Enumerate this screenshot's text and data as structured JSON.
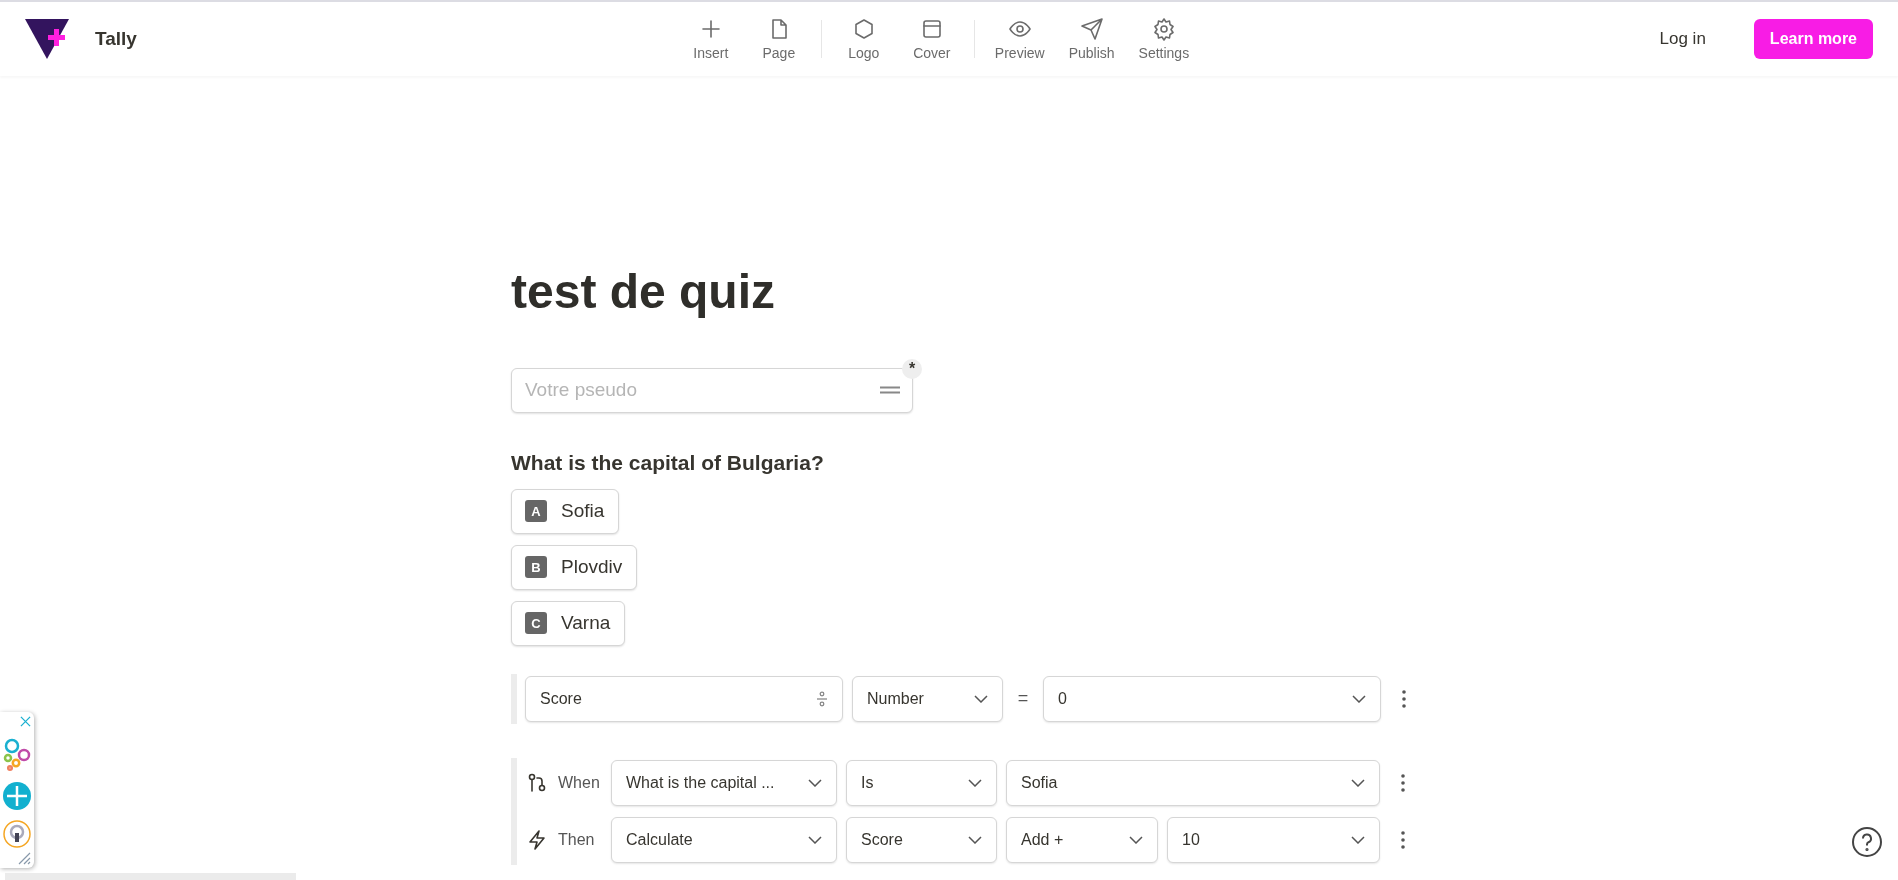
{
  "header": {
    "brand": "Tally",
    "toolbar": [
      [
        {
          "label": "Insert"
        },
        {
          "label": "Page"
        }
      ],
      [
        {
          "label": "Logo"
        },
        {
          "label": "Cover"
        }
      ],
      [
        {
          "label": "Preview"
        },
        {
          "label": "Publish"
        },
        {
          "label": "Settings"
        }
      ]
    ],
    "login": "Log in",
    "cta": "Learn more"
  },
  "form": {
    "title": "test de quiz",
    "name_field": {
      "placeholder": "Votre pseudo",
      "required_mark": "*"
    },
    "question": "What is the capital of Bulgaria?",
    "options": [
      {
        "letter": "A",
        "label": "Sofia"
      },
      {
        "letter": "B",
        "label": "Plovdiv"
      },
      {
        "letter": "C",
        "label": "Varna"
      }
    ],
    "logic_blocks": [
      {
        "rows": [
          {
            "controls": [
              {
                "kind": "field",
                "value": "Score"
              },
              {
                "kind": "select",
                "value": "Number"
              },
              {
                "kind": "operator",
                "value": "="
              },
              {
                "kind": "select",
                "value": "0"
              }
            ]
          }
        ]
      },
      {
        "rows": [
          {
            "kind": "condition",
            "label": "When",
            "controls": [
              {
                "kind": "select",
                "value": "What is the capital ..."
              },
              {
                "kind": "select",
                "value": "Is"
              },
              {
                "kind": "select",
                "value": "Sofia"
              }
            ]
          },
          {
            "kind": "action",
            "label": "Then",
            "controls": [
              {
                "kind": "select",
                "value": "Calculate"
              },
              {
                "kind": "select",
                "value": "Score"
              },
              {
                "kind": "select",
                "value": "Add +"
              },
              {
                "kind": "select",
                "value": "10"
              }
            ]
          }
        ]
      }
    ]
  }
}
